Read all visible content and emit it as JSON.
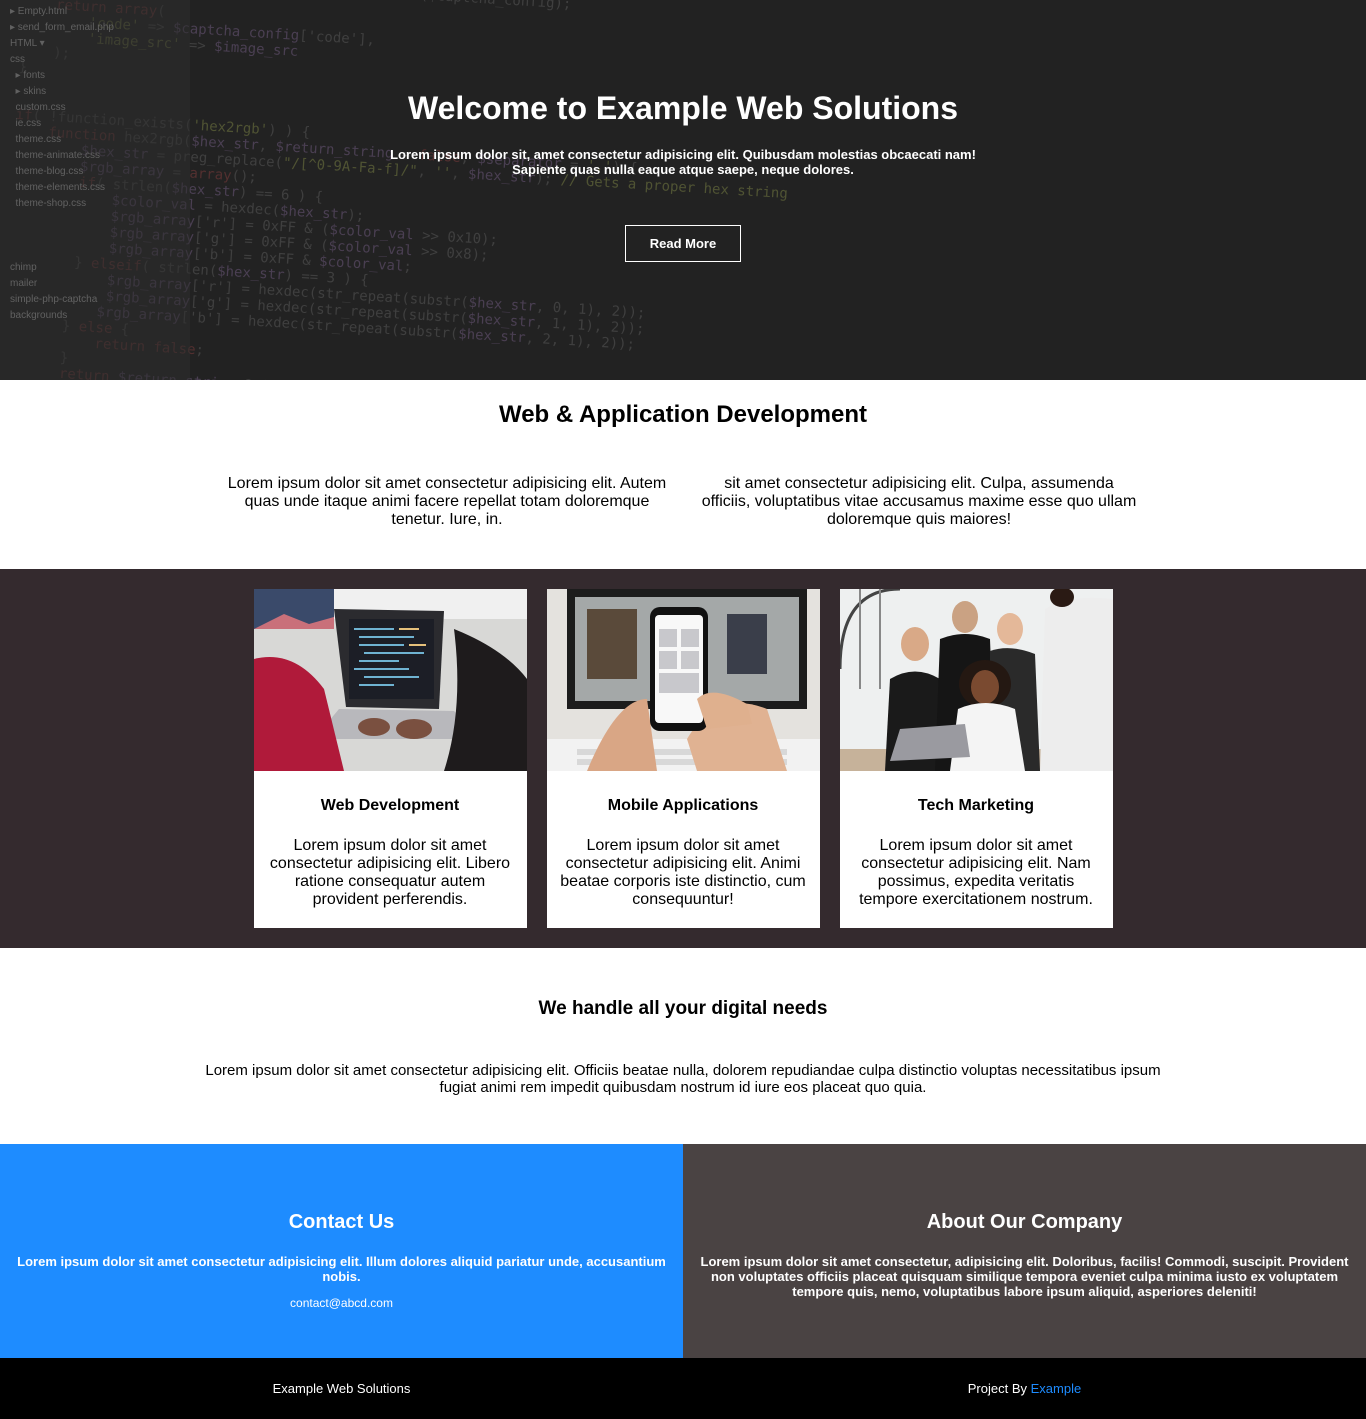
{
  "hero": {
    "title": "Welcome to Example Web Solutions",
    "text": "Lorem ipsum dolor sit, amet consectetur adipisicing elit. Quibusdam molestias obcaecati nam! Sapiente quas nulla eaque atque saepe, neque dolores.",
    "button_label": "Read More"
  },
  "dev": {
    "title": "Web & Application Development",
    "col1": "Lorem ipsum dolor sit amet consectetur adipisicing elit. Autem quas unde itaque animi facere repellat totam doloremque tenetur. Iure, in.",
    "col2": "sit amet consectetur adipisicing elit. Culpa, assumenda officiis, voluptatibus vitae accusamus maxime esse quo ullam doloremque quis maiores!"
  },
  "services": [
    {
      "title": "Web Development",
      "text": "Lorem ipsum dolor sit amet consectetur adipisicing elit. Libero ratione consequatur autem provident perferendis."
    },
    {
      "title": "Mobile Applications",
      "text": "Lorem ipsum dolor sit amet consectetur adipisicing elit. Animi beatae corporis iste distinctio, cum consequuntur!"
    },
    {
      "title": "Tech Marketing",
      "text": "Lorem ipsum dolor sit amet consectetur adipisicing elit. Nam possimus, expedita veritatis tempore exercitationem nostrum."
    }
  ],
  "needs": {
    "title": "We handle all your digital needs",
    "text": "Lorem ipsum dolor sit amet consectetur adipisicing elit. Officiis beatae nulla, dolorem repudiandae culpa distinctio voluptas necessitatibus ipsum fugiat animi rem impedit quibusdam nostrum id iure eos placeat quo quia."
  },
  "contact": {
    "title": "Contact Us",
    "text": "Lorem ipsum dolor sit amet consectetur adipisicing elit. Illum dolores aliquid pariatur unde, accusantium nobis.",
    "email": "contact@abcd.com",
    "bg_color": "#1e8cff"
  },
  "about": {
    "title": "About Our Company",
    "text": "Lorem ipsum dolor sit amet consectetur, adipisicing elit. Doloribus, facilis! Commodi, suscipit. Provident non voluptates officiis placeat quisquam similique tempora eveniet culpa minima iusto ex voluptatem tempore quis, nemo, voluptatibus labore ipsum aliquid, asperiores deleniti!",
    "bg_color": "#4a4343"
  },
  "footer": {
    "brand": "Example Web Solutions",
    "credit_prefix": "Project By",
    "credit_link": "Example",
    "link_color": "#1e8cff"
  }
}
